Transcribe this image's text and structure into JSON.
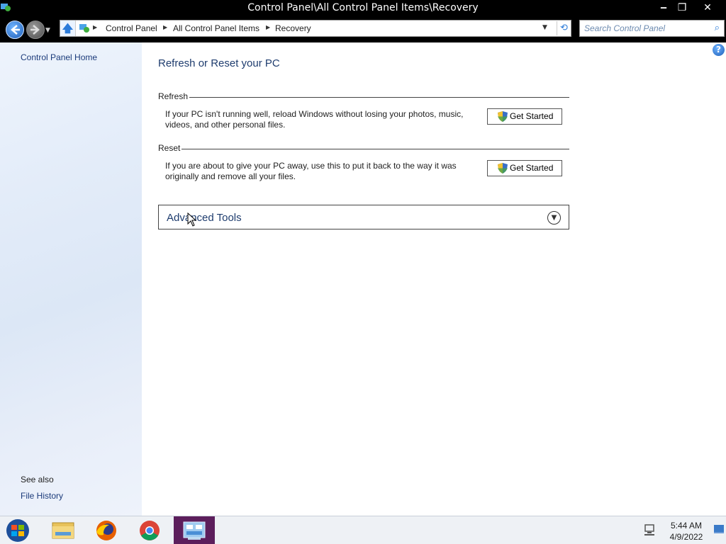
{
  "window": {
    "title": "Control Panel\\All Control Panel Items\\Recovery",
    "controls": {
      "minimize": "‒",
      "maximize": "❐",
      "close": "✕"
    }
  },
  "address_bar": {
    "breadcrumbs": [
      "Control Panel",
      "All Control Panel Items",
      "Recovery"
    ],
    "search_placeholder": "Search Control Panel"
  },
  "left_pane": {
    "home_link": "Control Panel Home",
    "see_also_label": "See also",
    "see_also_links": [
      "File History"
    ]
  },
  "main": {
    "title": "Refresh or Reset your PC",
    "sections": [
      {
        "heading": "Refresh",
        "description": "If your PC isn't running well, reload Windows without losing your photos, music, videos, and other personal files.",
        "button_label": "Get Started"
      },
      {
        "heading": "Reset",
        "description": "If you are about to give your PC away, use this to put it back to the way it was originally and remove all your files.",
        "button_label": "Get Started"
      }
    ],
    "advanced_tools_label": "Advanced Tools",
    "help_glyph": "?"
  },
  "taskbar": {
    "items": [
      "file-explorer-icon",
      "firefox-icon",
      "chrome-icon",
      "control-panel-icon"
    ],
    "active_item": "control-panel-icon",
    "time": "5:44 AM",
    "date": "4/9/2022"
  },
  "colors": {
    "title_bar": "#000000",
    "link": "#1b3a7a",
    "heading": "#1e3c6e",
    "active_taskbar": "#5c1e5c"
  }
}
